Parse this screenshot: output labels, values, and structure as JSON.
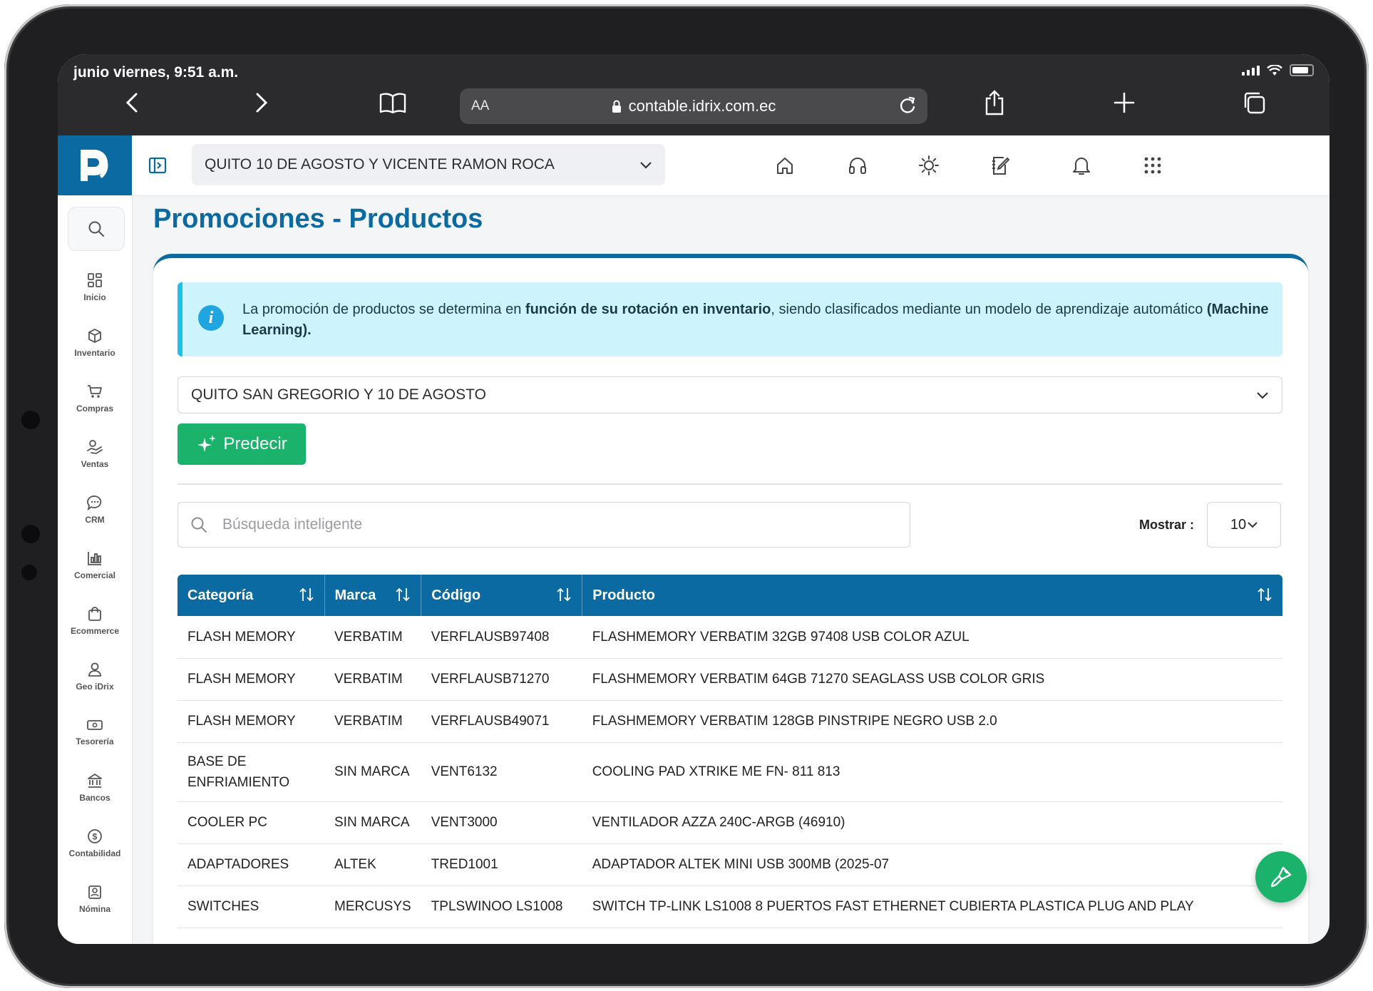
{
  "status": {
    "time": "junio viernes, 9:51 a.m."
  },
  "browser": {
    "aa_label": "AA",
    "url": "contable.idrix.com.ec"
  },
  "header": {
    "branch": "QUITO 10 DE AGOSTO Y VICENTE RAMON ROCA"
  },
  "sidebar": {
    "items": [
      {
        "label": "Inicio",
        "icon": "grid-icon"
      },
      {
        "label": "Inventario",
        "icon": "box-icon"
      },
      {
        "label": "Compras",
        "icon": "cart-icon"
      },
      {
        "label": "Ventas",
        "icon": "hand-coin-icon"
      },
      {
        "label": "CRM",
        "icon": "chat-icon"
      },
      {
        "label": "Comercial",
        "icon": "bar-chart-icon"
      },
      {
        "label": "Ecommerce",
        "icon": "bag-icon"
      },
      {
        "label": "Geo iDrix",
        "icon": "user-pin-icon"
      },
      {
        "label": "Tesorería",
        "icon": "cash-icon"
      },
      {
        "label": "Bancos",
        "icon": "bank-icon"
      },
      {
        "label": "Contabilidad",
        "icon": "dollar-circle-icon"
      },
      {
        "label": "Nómina",
        "icon": "badge-icon"
      }
    ]
  },
  "page": {
    "title": "Promociones - Productos",
    "alert": {
      "part1": "La promoción de productos se determina en ",
      "bold1": "función de su rotación en inventario",
      "part2": ", siendo clasificados mediante un modelo de aprendizaje automático ",
      "bold2": "(Machine Learning)."
    },
    "store": "QUITO SAN GREGORIO Y 10 DE AGOSTO",
    "predict_label": "Predecir",
    "search_placeholder": "Búsqueda inteligente",
    "show_label": "Mostrar :",
    "show_value": "10"
  },
  "table": {
    "headers": [
      "Categoría",
      "Marca",
      "Código",
      "Producto"
    ],
    "rows": [
      [
        "FLASH MEMORY",
        "VERBATIM",
        "VERFLAUSB97408",
        "FLASHMEMORY VERBATIM 32GB 97408 USB COLOR AZUL"
      ],
      [
        "FLASH MEMORY",
        "VERBATIM",
        "VERFLAUSB71270",
        "FLASHMEMORY VERBATIM 64GB 71270 SEAGLASS USB COLOR GRIS"
      ],
      [
        "FLASH MEMORY",
        "VERBATIM",
        "VERFLAUSB49071",
        "FLASHMEMORY VERBATIM 128GB PINSTRIPE NEGRO USB 2.0"
      ],
      [
        "BASE DE ENFRIAMIENTO",
        "SIN MARCA",
        "VENT6132",
        "COOLING PAD XTRIKE ME FN- 811 813"
      ],
      [
        "COOLER PC",
        "SIN MARCA",
        "VENT3000",
        "VENTILADOR AZZA 240C-ARGB (46910)"
      ],
      [
        "ADAPTADORES",
        "ALTEK",
        "TRED1001",
        "ADAPTADOR ALTEK MINI USB 300MB (2025-07"
      ],
      [
        "SWITCHES",
        "MERCUSYS",
        "TPLSWINOO LS1008",
        "SWITCH TP-LINK LS1008 8 PUERTOS FAST ETHERNET CUBIERTA PLASTICA PLUG AND PLAY"
      ]
    ]
  },
  "colors": {
    "primary": "#0a6aa1",
    "success": "#1bb36b",
    "info_bg": "#cdf4fc",
    "info_border": "#1fc0e6"
  }
}
